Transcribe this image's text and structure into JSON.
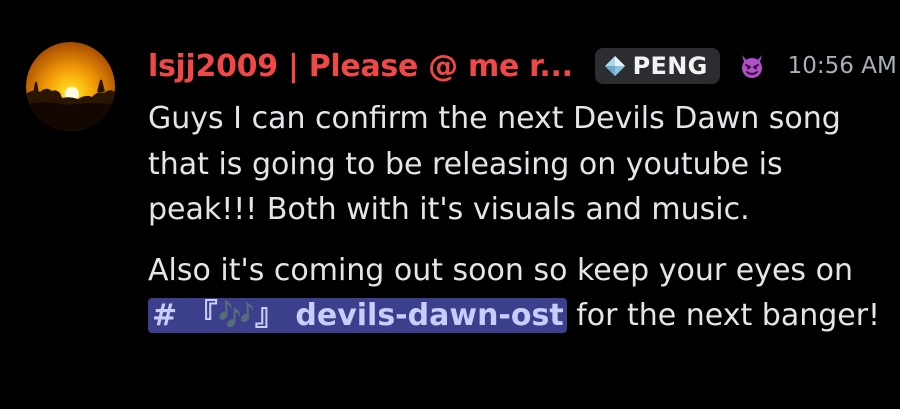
{
  "message": {
    "username": "lsjj2009 | Please @ me r...",
    "tag": {
      "label": "PENG",
      "icon": "diamond-icon"
    },
    "role_icon": "devil-face-icon",
    "timestamp": "10:56 AM",
    "paragraph1": "Guys I can confirm the next Devils Dawn song that is going to be releasing on youtube is peak!!! Both with it's visuals and music.",
    "paragraph2_prefix": "Also it's coming out soon so keep your eyes on ",
    "channel_mention": "# 『🎶』 devils-dawn-ost",
    "paragraph2_suffix": " for the next banger!"
  },
  "colors": {
    "background": "#000000",
    "username": "#f04747",
    "mention_bg": "#3c3f8c",
    "mention_text": "#c9cdfb",
    "text": "#e3e5e8",
    "timestamp": "#aab0b8",
    "tag_bg": "#2b2d31"
  }
}
